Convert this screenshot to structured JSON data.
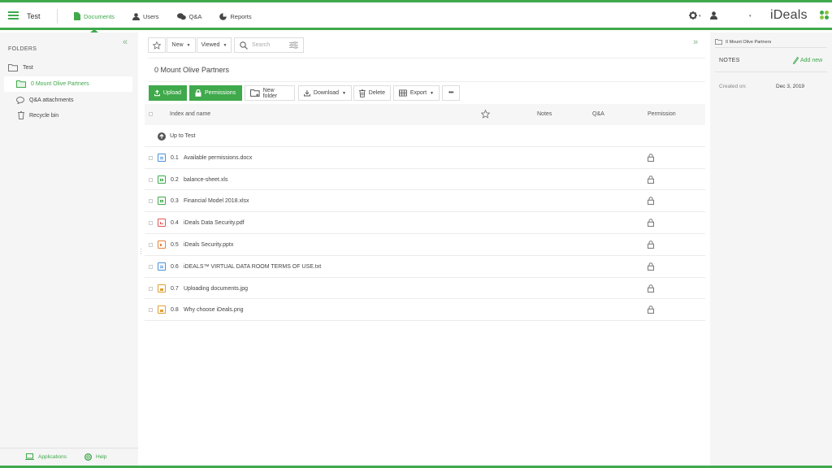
{
  "header": {
    "room_title": "Test",
    "nav": [
      {
        "label": "Documents",
        "icon": "document-icon",
        "active": true
      },
      {
        "label": "Users",
        "icon": "user-icon",
        "active": false
      },
      {
        "label": "Q&A",
        "icon": "chat-bubbles-icon",
        "active": false
      },
      {
        "label": "Reports",
        "icon": "pie-chart-icon",
        "active": false
      }
    ],
    "logo_text": "iDeals",
    "accent_color": "#3fa94b"
  },
  "sidebar": {
    "heading": "FOLDERS",
    "items": [
      {
        "label": "Test",
        "icon": "folder-open-icon",
        "selected": false
      },
      {
        "label": "0 Mount Olive Partners",
        "icon": "folder-icon",
        "selected": true
      },
      {
        "label": "Q&A attachments",
        "icon": "chat-bubble-icon",
        "selected": false
      },
      {
        "label": "Recycle bin",
        "icon": "trash-icon",
        "selected": false
      }
    ],
    "footer": {
      "applications": "Applications",
      "help": "Help"
    }
  },
  "toolbar": {
    "new_label": "New",
    "viewed_label": "Viewed",
    "search_placeholder": "Search"
  },
  "folder": {
    "name": "0 Mount Olive Partners"
  },
  "actions": {
    "upload": "Upload",
    "permissions": "Permissions",
    "new_folder": "New folder",
    "download": "Download",
    "delete": "Delete",
    "export": "Export",
    "more": "•••"
  },
  "table": {
    "headers": {
      "name": "Index and name",
      "notes": "Notes",
      "qa": "Q&A",
      "permission": "Permission"
    },
    "up_row": "Up to Test",
    "rows": [
      {
        "index": "0.1",
        "name": "Available permissions.docx",
        "type": "docx",
        "color": "#4a90d9"
      },
      {
        "index": "0.2",
        "name": "balance-sheet.xls",
        "type": "xls",
        "color": "#3fa94b"
      },
      {
        "index": "0.3",
        "name": "Financial Model 2018.xlsx",
        "type": "xlsx",
        "color": "#3fa94b"
      },
      {
        "index": "0.4",
        "name": "iDeals Data Security.pdf",
        "type": "pdf",
        "color": "#e05656"
      },
      {
        "index": "0.5",
        "name": "iDeals Security.pptx",
        "type": "pptx",
        "color": "#e8833a"
      },
      {
        "index": "0.6",
        "name": "iDEALS™ VIRTUAL DATA ROOM TERMS OF USE.txt",
        "type": "txt",
        "color": "#4a90d9"
      },
      {
        "index": "0.7",
        "name": "Uploading documents.jpg",
        "type": "jpg",
        "color": "#e0a030"
      },
      {
        "index": "0.8",
        "name": "Why choose iDeals.png",
        "type": "png",
        "color": "#e0a030"
      }
    ]
  },
  "right_panel": {
    "breadcrumb": "0 Mount Olive Partners",
    "notes_heading": "NOTES",
    "add_new": "Add new",
    "created_label": "Created on:",
    "created_value": "Dec 3, 2019"
  }
}
